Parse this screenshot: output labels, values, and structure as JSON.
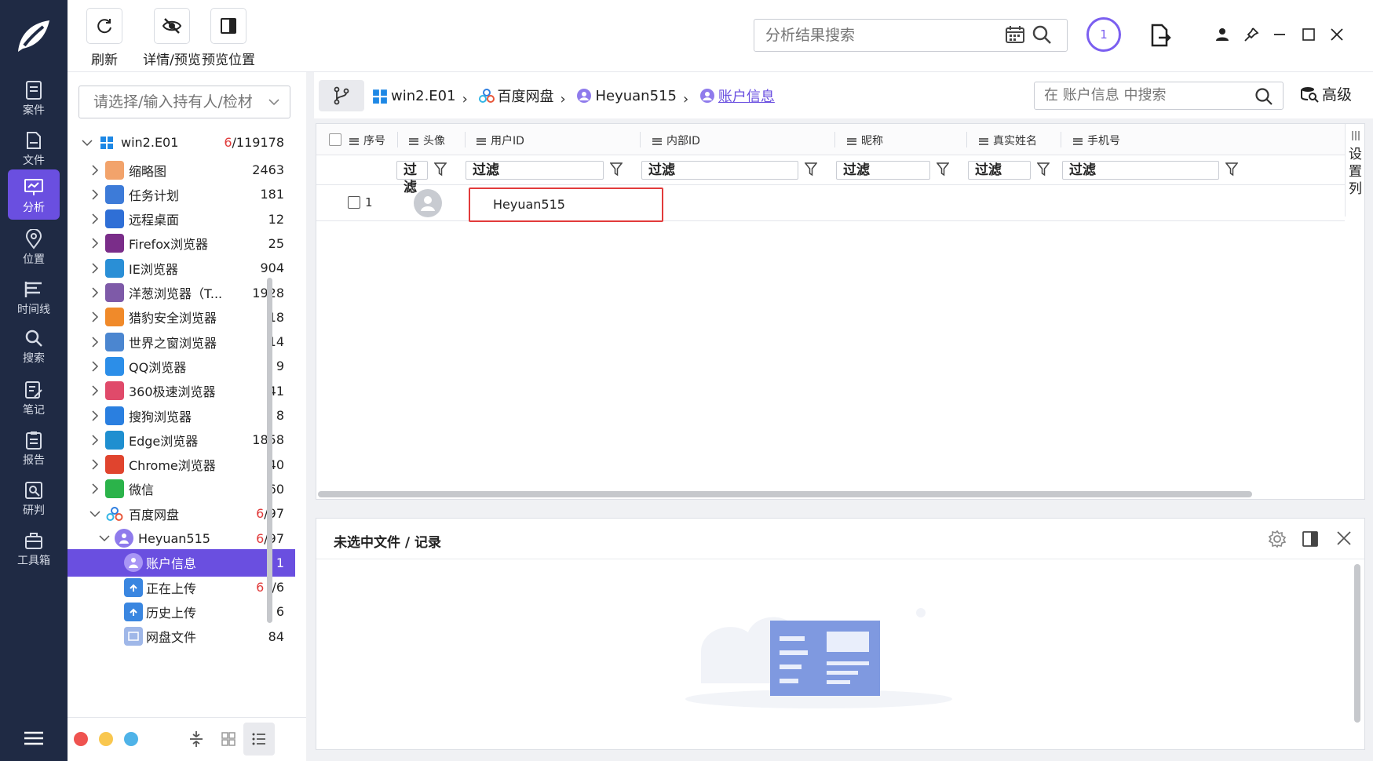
{
  "nav": {
    "items": [
      {
        "id": "cases",
        "label": "案件"
      },
      {
        "id": "files",
        "label": "文件"
      },
      {
        "id": "analysis",
        "label": "分析"
      },
      {
        "id": "location",
        "label": "位置"
      },
      {
        "id": "timeline",
        "label": "时间线"
      },
      {
        "id": "search",
        "label": "搜索"
      },
      {
        "id": "notes",
        "label": "笔记"
      },
      {
        "id": "report",
        "label": "报告"
      },
      {
        "id": "judge",
        "label": "研判"
      },
      {
        "id": "toolbox",
        "label": "工具箱"
      }
    ]
  },
  "toolbar": {
    "refresh_label": "刷新",
    "details_label": "详情/预览",
    "preview_pos_label": "预览位置",
    "search_placeholder": "分析结果搜索",
    "task_count": "1"
  },
  "tree": {
    "filter_placeholder": "请选择/输入持有人/检材",
    "root": {
      "label": "win2.E01",
      "count_hit": "6",
      "count_total": "/119178"
    },
    "items": [
      {
        "label": "缩略图",
        "count": "2463",
        "color": "#f2a36b"
      },
      {
        "label": "任务计划",
        "count": "181",
        "color": "#3d7bd8"
      },
      {
        "label": "远程桌面",
        "count": "12",
        "color": "#2f6fd6"
      },
      {
        "label": "Firefox浏览器",
        "count": "25",
        "color": "#7a2d89"
      },
      {
        "label": "IE浏览器",
        "count": "904",
        "color": "#2a8fd6"
      },
      {
        "label": "洋葱浏览器（T...",
        "count": "1928",
        "color": "#7e5aa8"
      },
      {
        "label": "猎豹安全浏览器",
        "count": "18",
        "color": "#f08a2a"
      },
      {
        "label": "世界之窗浏览器",
        "count": "14",
        "color": "#4b86d0"
      },
      {
        "label": "QQ浏览器",
        "count": "9",
        "color": "#2c8ee8"
      },
      {
        "label": "360极速浏览器",
        "count": "41",
        "color": "#e04a6a"
      },
      {
        "label": "搜狗浏览器",
        "count": "8",
        "color": "#2a7fe0"
      },
      {
        "label": "Edge浏览器",
        "count": "1858",
        "color": "#1f8fd0"
      },
      {
        "label": "Chrome浏览器",
        "count": "40",
        "color": "#e0442e"
      },
      {
        "label": "微信",
        "count": "60",
        "color": "#2bb34a"
      }
    ],
    "baidu": {
      "label": "百度网盘",
      "count_hit": "6",
      "count_total": "/97"
    },
    "account": {
      "label": "Heyuan515",
      "count_hit": "6",
      "count_total": "/97"
    },
    "children": [
      {
        "label": "账户信息",
        "count": "1"
      },
      {
        "label": "正在上传",
        "count_hit": "6",
        "count_total": "/6"
      },
      {
        "label": "历史上传",
        "count": "6"
      },
      {
        "label": "网盘文件",
        "count": "84"
      }
    ]
  },
  "breadcrumb": [
    {
      "label": "win2.E01"
    },
    {
      "label": "百度网盘"
    },
    {
      "label": "Heyuan515"
    },
    {
      "label": "账户信息"
    }
  ],
  "tab_search_placeholder": "在 账户信息 中搜索",
  "advanced_label": "高级",
  "table": {
    "columns": [
      "序号",
      "头像",
      "用户ID",
      "内部ID",
      "昵称",
      "真实姓名",
      "手机号"
    ],
    "filter_label": "过滤",
    "rows": [
      {
        "index": "1",
        "user_id": "Heyuan515"
      }
    ],
    "set_columns_label": "设置列"
  },
  "detail": {
    "title": "未选中文件 / 记录"
  }
}
